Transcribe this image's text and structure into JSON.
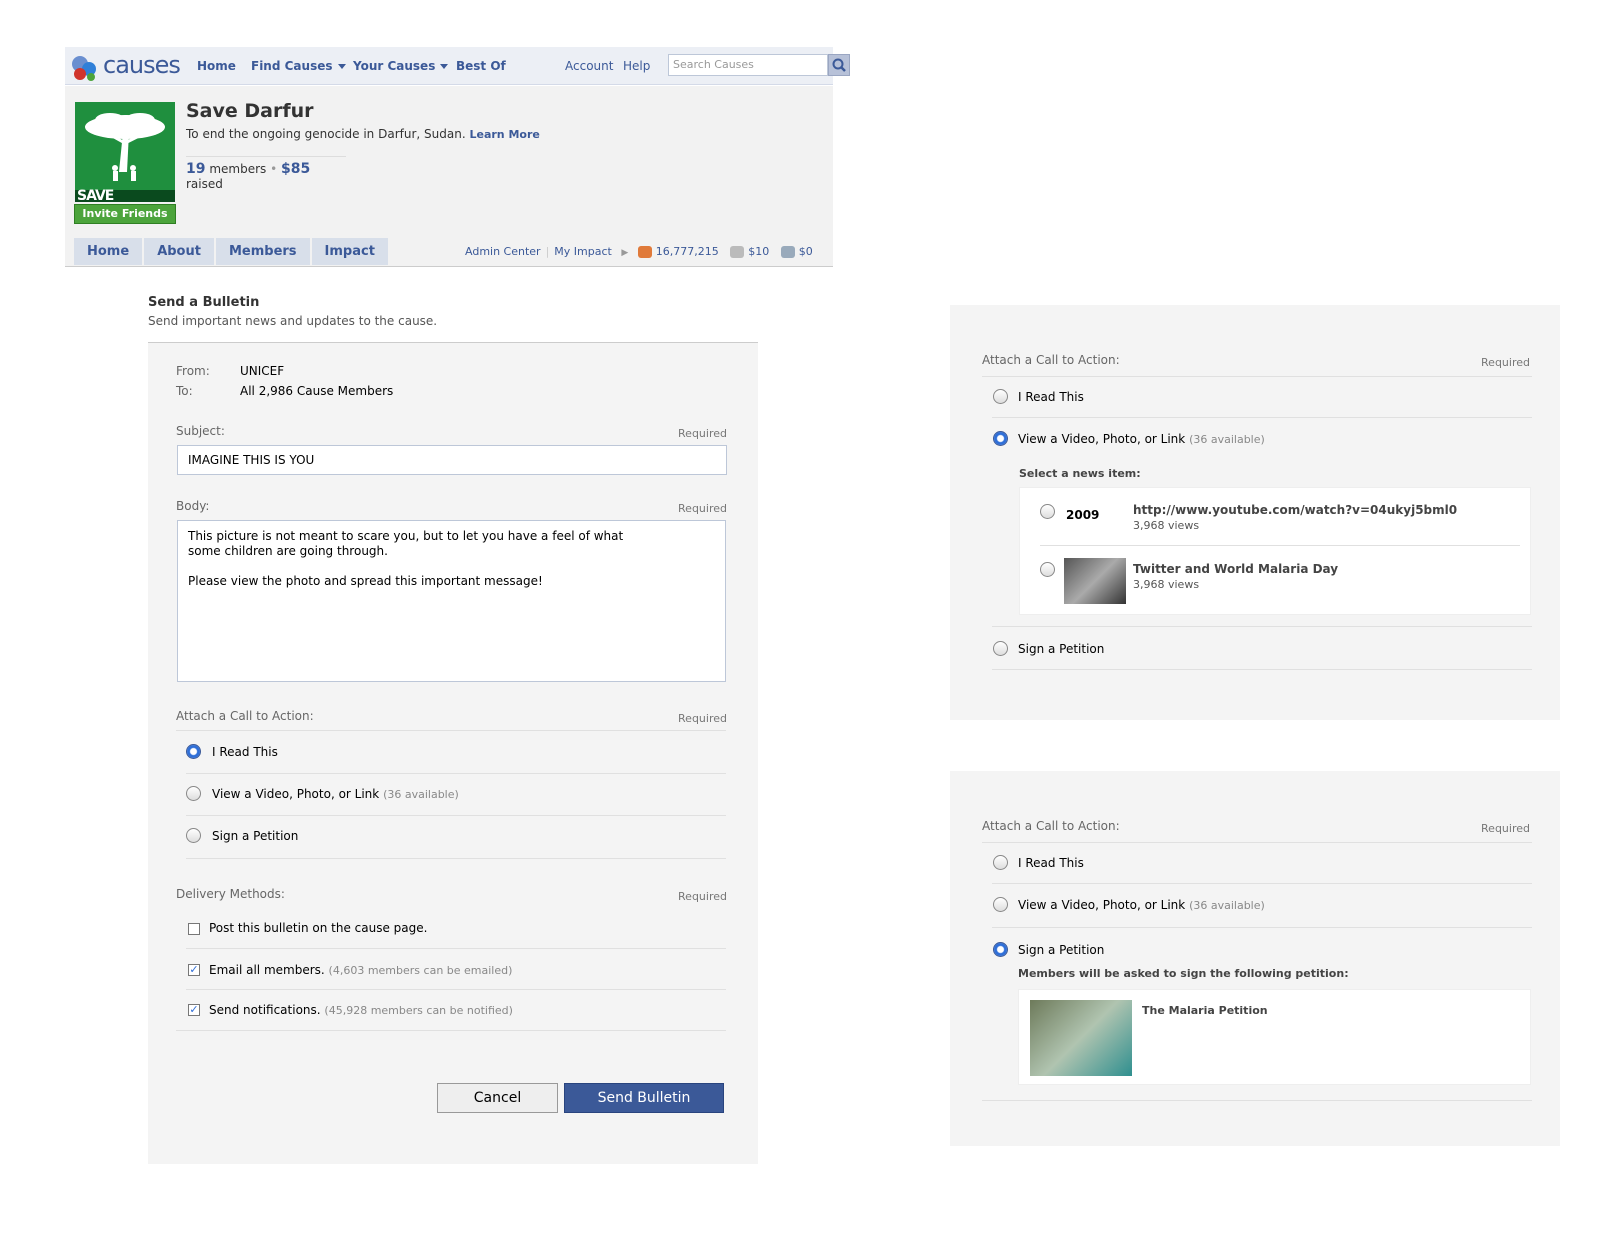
{
  "topbar": {
    "logo_text": "causes",
    "nav": [
      "Home",
      "Find Causes",
      "Your Causes",
      "Best Of"
    ],
    "account": "Account",
    "help": "Help",
    "search_placeholder": "Search Causes"
  },
  "cause": {
    "title": "Save Darfur",
    "description": "To end the ongoing genocide in Darfur, Sudan.",
    "learn_more": "Learn More",
    "members_count": "19",
    "members_label": "members",
    "raised_amount": "$85",
    "raised_label": "raised",
    "logo_text": "SAVE DARFUR",
    "invite_label": "Invite Friends"
  },
  "tabs": [
    "Home",
    "About",
    "Members",
    "Impact"
  ],
  "impact_links": {
    "admin_center": "Admin Center",
    "my_impact": "My Impact",
    "people_count": "16,777,215",
    "donated": "$10",
    "raised": "$0"
  },
  "bulletin": {
    "title": "Send a Bulletin",
    "subtitle": "Send important news and updates to the cause.",
    "from_label": "From:",
    "from_value": "UNICEF",
    "to_label": "To:",
    "to_value": "All 2,986 Cause Members",
    "subject_label": "Subject:",
    "required": "Required",
    "subject_value": "IMAGINE THIS IS YOU",
    "body_label": "Body:",
    "body_line1": "This picture is not meant to scare you, but to let you have a feel of what",
    "body_line2": "some children are going through.",
    "body_line3": "Please view the photo and spread this important message!",
    "cta_label": "Attach a Call to Action:",
    "cta_options": [
      {
        "label": "I Read This",
        "selected": true
      },
      {
        "label": "View a Video, Photo, or Link",
        "extra": "(36 available)",
        "selected": false
      },
      {
        "label": "Sign a Petition",
        "selected": false
      }
    ],
    "delivery_label": "Delivery Methods:",
    "delivery": [
      {
        "label": "Post this bulletin on the cause page.",
        "extra": "",
        "checked": false
      },
      {
        "label": "Email all members.",
        "extra": "(4,603 members can be emailed)",
        "checked": true
      },
      {
        "label": "Send notifications.",
        "extra": "(45,928 members can be notified)",
        "checked": true
      }
    ],
    "cancel_label": "Cancel",
    "send_label": "Send Bulletin"
  },
  "panel_video": {
    "cta_label": "Attach a Call to Action:",
    "required": "Required",
    "opt1": "I Read This",
    "opt2": "View a Video, Photo, or Link",
    "opt2_extra": "(36 available)",
    "opt3": "Sign a Petition",
    "select_label": "Select a news item:",
    "items": [
      {
        "thumb_text": "2009",
        "title": "http://www.youtube.com/watch?v=04ukyj5bml0",
        "views": "3,968 views"
      },
      {
        "thumb_text": "",
        "title": "Twitter and World Malaria Day",
        "views": "3,968 views"
      }
    ]
  },
  "panel_petition": {
    "cta_label": "Attach a Call to Action:",
    "required": "Required",
    "opt1": "I Read This",
    "opt2": "View a Video, Photo, or Link",
    "opt2_extra": "(36 available)",
    "opt3": "Sign a Petition",
    "petition_prompt": "Members will be asked to sign the following petition:",
    "petition_title": "The Malaria Petition"
  },
  "colors": {
    "brand": "#3b5998",
    "invite_green": "#4ca43c",
    "logo_green": "#1f8f3e",
    "panel_bg": "#f4f4f4"
  }
}
